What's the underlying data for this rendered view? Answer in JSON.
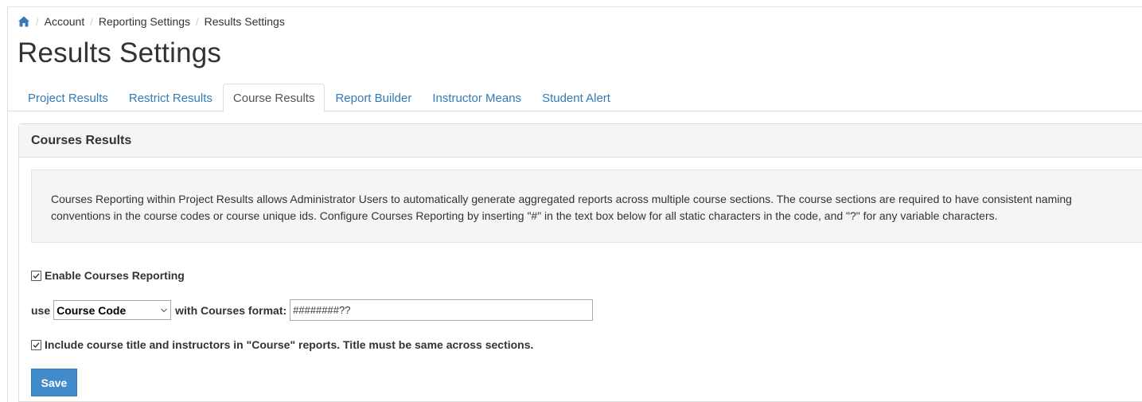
{
  "breadcrumb": {
    "home_icon": "home-icon",
    "items": [
      "Account",
      "Reporting Settings",
      "Results Settings"
    ]
  },
  "page_title": "Results Settings",
  "tabs": [
    {
      "label": "Project Results",
      "active": false
    },
    {
      "label": "Restrict Results",
      "active": false
    },
    {
      "label": "Course Results",
      "active": true
    },
    {
      "label": "Report Builder",
      "active": false
    },
    {
      "label": "Instructor Means",
      "active": false
    },
    {
      "label": "Student Alert",
      "active": false
    }
  ],
  "panel": {
    "heading": "Courses Results",
    "info_text": "Courses Reporting within Project Results allows Administrator Users to automatically generate aggregated reports across multiple course sections. The course sections are required to have consistent naming conventions in the course codes or course unique ids. Configure Courses Reporting by inserting \"#\" in the text box below for all static characters in the code, and \"?\" for any variable characters.",
    "enable_checkbox": {
      "label": "Enable Courses Reporting",
      "checked": true
    },
    "format_row": {
      "prefix": "use",
      "select_value": "Course Code",
      "middle": "with Courses format:",
      "format_value": "########??"
    },
    "include_checkbox": {
      "label": "Include course title and instructors in \"Course\" reports. Title must be same across sections.",
      "checked": true
    },
    "save_label": "Save"
  },
  "colors": {
    "link": "#337ab7",
    "primary_button": "#428bca",
    "panel_heading_bg": "#f5f5f5"
  }
}
